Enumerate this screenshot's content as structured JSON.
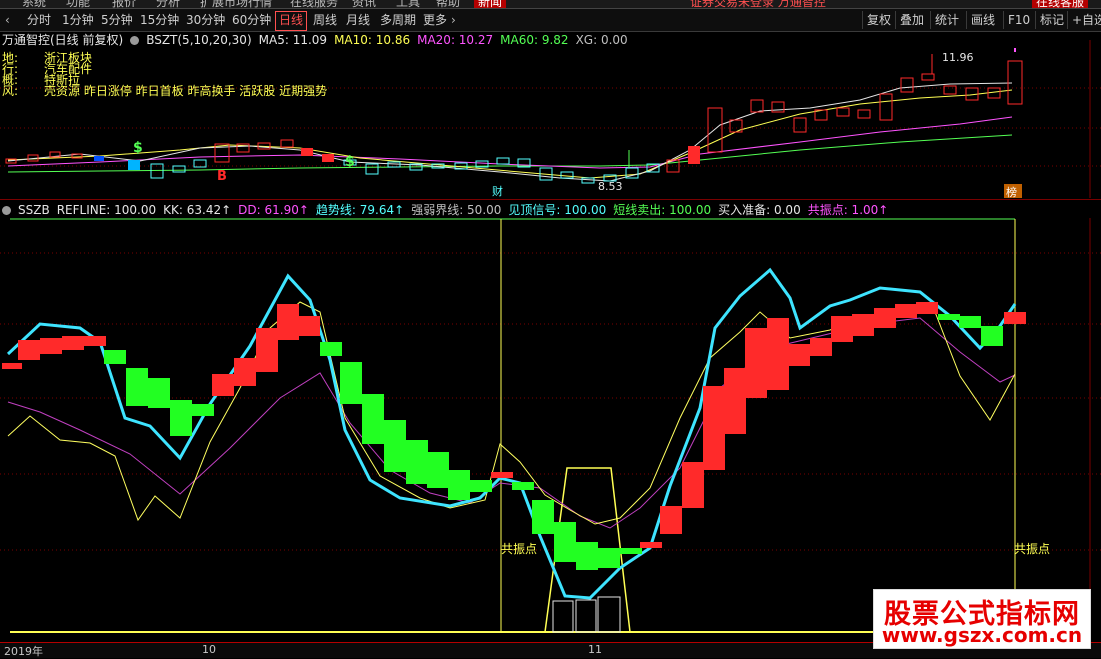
{
  "top_menu": {
    "items": [
      "系统",
      "功能",
      "报价",
      "分析",
      "扩展市场行情",
      "在线服务",
      "资讯",
      "工具",
      "帮助"
    ],
    "highlight": "新闻",
    "notice": "证券交易未登录 万通智控",
    "right_button": "在线客服"
  },
  "toolbar": {
    "periods": [
      "分时",
      "1分钟",
      "5分钟",
      "15分钟",
      "30分钟",
      "60分钟",
      "日线",
      "周线",
      "月线",
      "多周期",
      "更多"
    ],
    "active": "日线",
    "right": [
      "复权",
      "叠加",
      "统计",
      "画线",
      "F10",
      "标记",
      "+自选"
    ]
  },
  "main_header": {
    "title": "万通智控(日线 前复权)",
    "indicator": "BSZT(5,10,20,30)",
    "ma5": "MA5: 11.09",
    "ma10": "MA10: 10.86",
    "ma20": "MA20: 10.27",
    "ma60": "MA60: 9.82",
    "xg": "XG: 0.00"
  },
  "info": {
    "lines": [
      {
        "key": "地:",
        "value": "浙江板块"
      },
      {
        "key": "行:",
        "value": "汽车配件"
      },
      {
        "key": "概:",
        "value": "特斯拉"
      },
      {
        "key": "风:",
        "value": "壳资源 昨日涨停 昨日首板 昨高换手 活跃股 近期强势"
      }
    ]
  },
  "main_chart": {
    "high_label": "11.96",
    "low_label": "8.53",
    "markers": [
      "B",
      "$",
      "$",
      "财",
      "榜"
    ]
  },
  "sub_header": {
    "name": "SSZB",
    "items": [
      {
        "text": "REFLINE: 100.00",
        "color": "#e6e6e6"
      },
      {
        "text": "KK: 63.42↑",
        "color": "#e6e6e6"
      },
      {
        "text": "DD: 61.90↑",
        "color": "#ff54ff"
      },
      {
        "text": "趋势线: 79.64↑",
        "color": "#54ffff"
      },
      {
        "text": "强弱界线: 50.00",
        "color": "#c0c0c0"
      },
      {
        "text": "见顶信号: 100.00",
        "color": "#54ffff"
      },
      {
        "text": "短线卖出: 100.00",
        "color": "#54ff54"
      },
      {
        "text": "买入准备: 0.00",
        "color": "#e6e6e6"
      },
      {
        "text": "共振点: 1.00↑",
        "color": "#ff54ff"
      }
    ]
  },
  "sub_chart": {
    "resonance_label": "共振点"
  },
  "bottom_axis": {
    "labels": [
      "2019年",
      "10",
      "11"
    ]
  },
  "watermark": {
    "line1": "股票公式指标网",
    "line2": "www.gszx.com.cn"
  },
  "colors": {
    "up": "#ff2a2a",
    "down": "#22ff22",
    "trend": "#3ee4ff",
    "dd": "#c040c0",
    "kk": "#ffff60",
    "ma5": "#e6e6e6",
    "ma10": "#ffff54",
    "ma20": "#ff54ff",
    "ma60": "#54ff54"
  }
}
